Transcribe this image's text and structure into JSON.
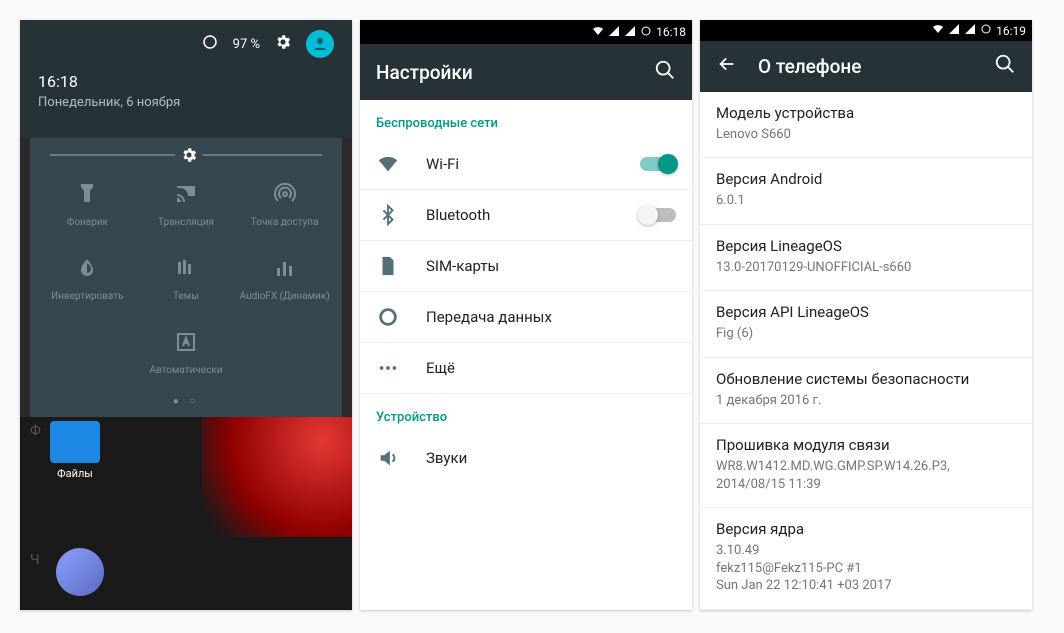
{
  "phone1": {
    "battery_pct": "97 %",
    "time": "16:18",
    "date": "Понедельник, 6 ноября",
    "tiles": [
      {
        "name": "flashlight",
        "label": "Фонарик"
      },
      {
        "name": "cast",
        "label": "Трансляция"
      },
      {
        "name": "hotspot",
        "label": "Точка доступа"
      },
      {
        "name": "invert",
        "label": "Инвертировать"
      },
      {
        "name": "themes",
        "label": "Темы"
      },
      {
        "name": "audiofx",
        "label": "AudioFX (Динамик)"
      },
      {
        "name": "auto",
        "label": "Автоматически"
      }
    ],
    "folder_label": "Файлы"
  },
  "phone2": {
    "status_time": "16:18",
    "title": "Настройки",
    "section_wireless": "Беспроводные сети",
    "section_device": "Устройство",
    "items": {
      "wifi": "Wi-Fi",
      "bluetooth": "Bluetooth",
      "sim": "SIM-карты",
      "data": "Передача данных",
      "more": "Ещё",
      "sound": "Звуки"
    }
  },
  "phone3": {
    "status_time": "16:19",
    "title": "О телефоне",
    "items": [
      {
        "t": "Модель устройства",
        "s": "Lenovo S660"
      },
      {
        "t": "Версия Android",
        "s": "6.0.1"
      },
      {
        "t": "Версия LineageOS",
        "s": "13.0-20170129-UNOFFICIAL-s660"
      },
      {
        "t": "Версия API LineageOS",
        "s": "Fig (6)"
      },
      {
        "t": "Обновление системы безопасности",
        "s": "1 декабря 2016 г."
      },
      {
        "t": "Прошивка модуля связи",
        "s": "WR8.W1412.MD.WG.GMP.SP.W14.26.P3, 2014/08/15 11:39"
      },
      {
        "t": "Версия ядра",
        "s": "3.10.49\nfekz115@Fekz115-PC #1\nSun Jan 22 12:10:41 +03 2017"
      }
    ]
  }
}
